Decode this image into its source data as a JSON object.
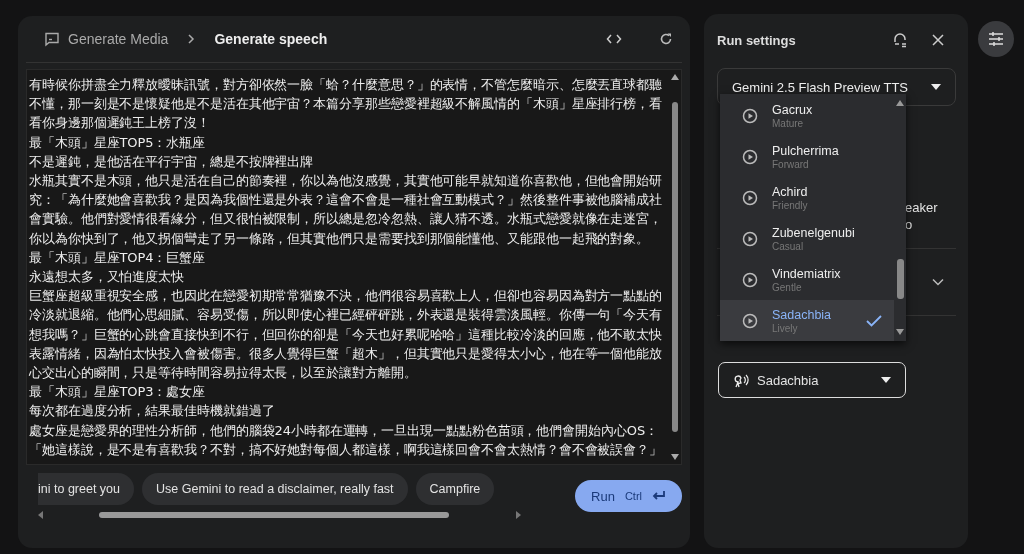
{
  "header": {
    "breadcrumb_parent": "Generate Media",
    "breadcrumb_current": "Generate speech"
  },
  "script_text": {
    "paragraphs": [
      "有時候你拼盡全力釋放曖昧訊號，對方卻依然一臉「蛤？什麼意思？」的表情，不管怎麼暗示、怎麼丟直球都聽不懂，那一刻是不是懷疑他是不是活在其他宇宙？本篇分享那些戀愛裡超級不解風情的「木頭」星座排行榜，看看你身邊那個遲鈍王上榜了沒！",
      "最「木頭」星座TOP5：水瓶座",
      "不是遲鈍，是他活在平行宇宙，總是不按牌裡出牌",
      "水瓶其實不是木頭，他只是活在自己的節奏裡，你以為他沒感覺，其實他可能早就知道你喜歡他，但他會開始研究：「為什麼她會喜歡我？是因為我個性還是外表？這會不會是一種社會互動模式？」然後整件事被他腦補成社會實驗。他們對愛情很看緣分，但又很怕被限制，所以總是忽冷忽熱、讓人猜不透。水瓶式戀愛就像在走迷宮，你以為你快到了，他又拐個彎走了另一條路，但其實他們只是需要找到那個能懂他、又能跟他一起飛的對象。",
      "最「木頭」星座TOP4：巨蟹座",
      "永遠想太多，又怕進度太快",
      "巨蟹座超級重視安全感，也因此在戀愛初期常常猶豫不決，他們很容易喜歡上人，但卻也容易因為對方一點點的冷淡就退縮。他們心思細膩、容易受傷，所以即使心裡已經砰砰跳，外表還是裝得雲淡風輕。你傳一句「今天有想我嗎？」巨蟹的心跳會直接快到不行，但回你的卻是「今天也好累呢哈哈」這種比較冷淡的回應，他不敢太快表露情緒，因為怕太快投入會被傷害。很多人覺得巨蟹「超木」，但其實他只是愛得太小心，他在等一個他能放心交出心的瞬間，只是等待時間容易拉得太長，以至於讓對方離開。",
      "最「木頭」星座TOP3：處女座",
      "每次都在過度分析，結果最佳時機就錯過了",
      "處女座是戀愛界的理性分析師，他們的腦袋24小時都在運轉，一旦出現一點點粉色苗頭，他們會開始內心OS：「她這樣說，是不是有喜歡我？不對，搞不好她對每個人都這樣，啊我這樣回會不會太熱情？會不會被誤會？」"
    ]
  },
  "prompt_chips": [
    {
      "label": "ini to greet you"
    },
    {
      "label": "Use Gemini to read a disclaimer, really fast"
    },
    {
      "label": "Campfire"
    }
  ],
  "run_button": {
    "label": "Run",
    "shortcut": "Ctrl"
  },
  "settings": {
    "title": "Run settings",
    "model_select": {
      "value": "Gemini 2.5 Flash Preview TTS"
    },
    "hidden_texts": [
      "eaker",
      "o"
    ],
    "voice_options": [
      {
        "name": "Gacrux",
        "description": "Mature",
        "selected": false
      },
      {
        "name": "Pulcherrima",
        "description": "Forward",
        "selected": false
      },
      {
        "name": "Achird",
        "description": "Friendly",
        "selected": false
      },
      {
        "name": "Zubenelgenubi",
        "description": "Casual",
        "selected": false
      },
      {
        "name": "Vindemiatrix",
        "description": "Gentle",
        "selected": false
      },
      {
        "name": "Sadachbia",
        "description": "Lively",
        "selected": true
      }
    ],
    "voice_select": {
      "value": "Sadachbia"
    }
  }
}
